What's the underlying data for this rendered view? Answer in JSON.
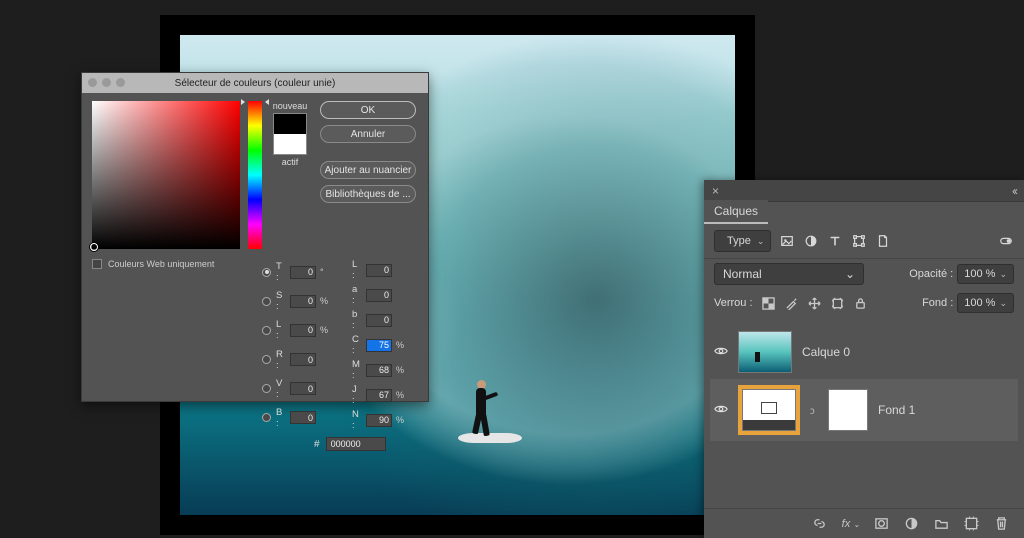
{
  "picker": {
    "title": "Sélecteur de couleurs (couleur unie)",
    "new_label": "nouveau",
    "current_label": "actif",
    "buttons": {
      "ok": "OK",
      "cancel": "Annuler",
      "add_swatch": "Ajouter au nuancier",
      "libraries": "Bibliothèques de ..."
    },
    "web_only": "Couleurs Web uniquement",
    "hsb": {
      "t": "0",
      "s": "0",
      "l": "0"
    },
    "hsb_labels": {
      "t": "T :",
      "s": "S :",
      "l": "L :"
    },
    "hsb_units": {
      "t": "°",
      "s": "%",
      "l": "%"
    },
    "rgb": {
      "r": "0",
      "v": "0",
      "b": "0"
    },
    "rgb_labels": {
      "r": "R :",
      "v": "V :",
      "b": "B :"
    },
    "lab": {
      "L": "0",
      "a": "0",
      "b": "0"
    },
    "lab_labels": {
      "L": "L :",
      "a": "a :",
      "b": "b :"
    },
    "cmjn": {
      "c": "75",
      "m": "68",
      "j": "67",
      "n": "90"
    },
    "cmjn_labels": {
      "c": "C :",
      "m": "M :",
      "j": "J :",
      "n": "N :"
    },
    "cmjn_unit": "%",
    "hex_prefix": "#",
    "hex": "000000"
  },
  "layers_panel": {
    "title": "Calques",
    "filter_label": "Type",
    "blend_mode": "Normal",
    "opacity_label": "Opacité :",
    "opacity_value": "100 %",
    "lock_label": "Verrou :",
    "fill_label": "Fond :",
    "fill_value": "100 %",
    "fx_label": "fx",
    "layers": [
      {
        "name": "Calque 0"
      },
      {
        "name": "Fond 1"
      }
    ]
  }
}
